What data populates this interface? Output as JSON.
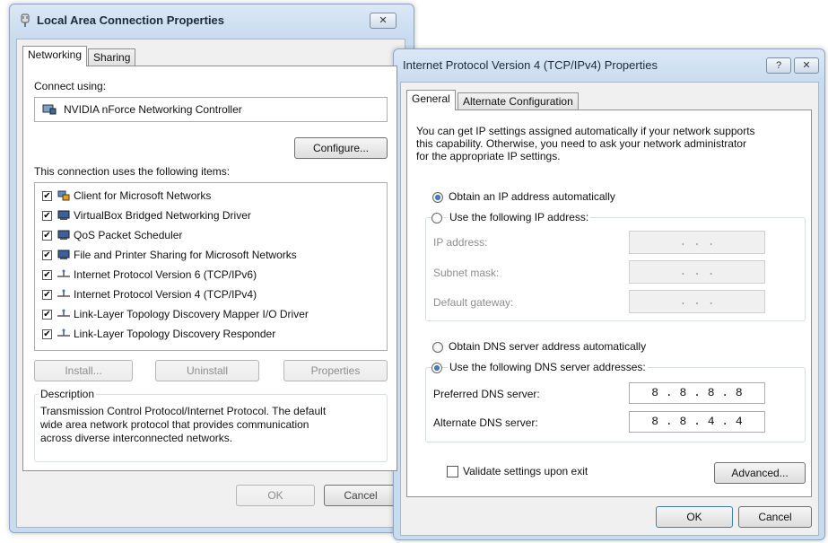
{
  "lan_dialog": {
    "title": "Local Area Connection Properties",
    "close_label": "✕",
    "tabs": [
      {
        "label": "Networking"
      },
      {
        "label": "Sharing"
      }
    ],
    "connect_using_label": "Connect using:",
    "adapter_name": "NVIDIA nForce Networking Controller",
    "configure_label": "Configure...",
    "items_label": "This connection uses the following items:",
    "items": [
      {
        "label": "Client for Microsoft Networks",
        "checked": true,
        "icon": "client-icon"
      },
      {
        "label": "VirtualBox Bridged Networking Driver",
        "checked": true,
        "icon": "service-icon"
      },
      {
        "label": "QoS Packet Scheduler",
        "checked": true,
        "icon": "service-icon"
      },
      {
        "label": "File and Printer Sharing for Microsoft Networks",
        "checked": true,
        "icon": "service-icon"
      },
      {
        "label": "Internet Protocol Version 6 (TCP/IPv6)",
        "checked": true,
        "icon": "protocol-icon"
      },
      {
        "label": "Internet Protocol Version 4 (TCP/IPv4)",
        "checked": true,
        "icon": "protocol-icon"
      },
      {
        "label": "Link-Layer Topology Discovery Mapper I/O Driver",
        "checked": true,
        "icon": "protocol-icon"
      },
      {
        "label": "Link-Layer Topology Discovery Responder",
        "checked": true,
        "icon": "protocol-icon"
      }
    ],
    "install_label": "Install...",
    "uninstall_label": "Uninstall",
    "properties_label": "Properties",
    "description_label": "Description",
    "description_lines": [
      "Transmission Control Protocol/Internet Protocol. The default",
      "wide area network protocol that provides communication",
      "across diverse interconnected networks."
    ],
    "ok_label": "OK",
    "cancel_label": "Cancel"
  },
  "ipv4_dialog": {
    "title": "Internet Protocol Version 4 (TCP/IPv4) Properties",
    "help_label": "?",
    "close_label": "✕",
    "tabs": [
      {
        "label": "General"
      },
      {
        "label": "Alternate Configuration"
      }
    ],
    "intro_lines": [
      "You can get IP settings assigned automatically if your network supports",
      "this capability. Otherwise, you need to ask your network administrator",
      "for the appropriate IP settings."
    ],
    "obtain_ip_auto": "Obtain an IP address automatically",
    "use_following_ip": "Use the following IP address:",
    "ip_address_label": "IP address:",
    "subnet_mask_label": "Subnet mask:",
    "default_gateway_label": "Default gateway:",
    "empty_ip": ".     .     .",
    "obtain_dns_auto": "Obtain DNS server address automatically",
    "use_following_dns": "Use the following DNS server addresses:",
    "preferred_dns_label": "Preferred DNS server:",
    "preferred_dns_value": "8 . 8 . 8 . 8",
    "alternate_dns_label": "Alternate DNS server:",
    "alternate_dns_value": "8 . 8 . 4 . 4",
    "validate_label": "Validate settings upon exit",
    "advanced_label": "Advanced...",
    "ok_label": "OK",
    "cancel_label": "Cancel",
    "selected_ip_option": "automatic",
    "selected_dns_option": "manual",
    "validate_checked": false
  }
}
